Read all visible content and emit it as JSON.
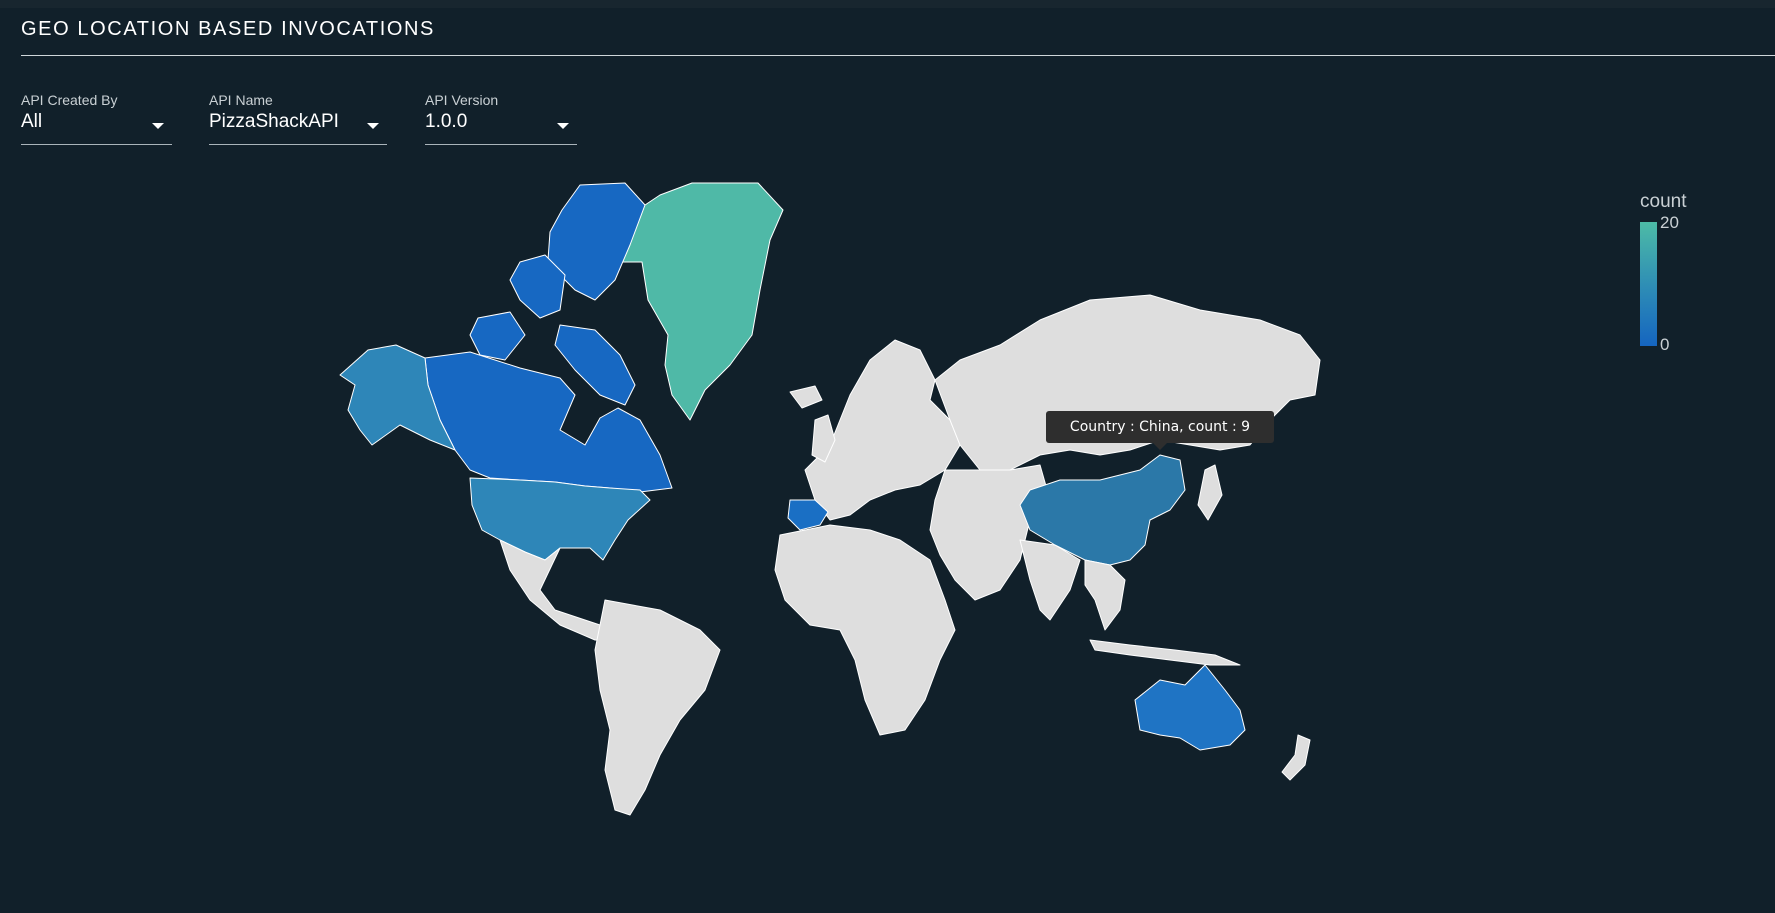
{
  "page": {
    "title": "GEO LOCATION BASED INVOCATIONS"
  },
  "filters": [
    {
      "label": "API Created By",
      "value": "All"
    },
    {
      "label": "API Name",
      "value": "PizzaShackAPI"
    },
    {
      "label": "API Version",
      "value": "1.0.0"
    }
  ],
  "legend": {
    "title": "count",
    "max": "20",
    "min": "0",
    "color_high": "#4dbba6",
    "color_low": "#1565c0"
  },
  "tooltip": {
    "text": "Country : China, count : 9"
  },
  "map": {
    "land_color": "#dedede",
    "highlighted_countries": [
      {
        "country": "Greenland",
        "color": "#4fb9a7"
      },
      {
        "country": "Canada",
        "color": "#1768c2"
      },
      {
        "country": "Alaska",
        "color": "#2e86b8"
      },
      {
        "country": "United States",
        "color": "#2e86b8"
      },
      {
        "country": "Spain",
        "color": "#1a6fc4"
      },
      {
        "country": "China",
        "color": "#2b78a8"
      },
      {
        "country": "Australia",
        "color": "#1f74c4"
      }
    ]
  }
}
